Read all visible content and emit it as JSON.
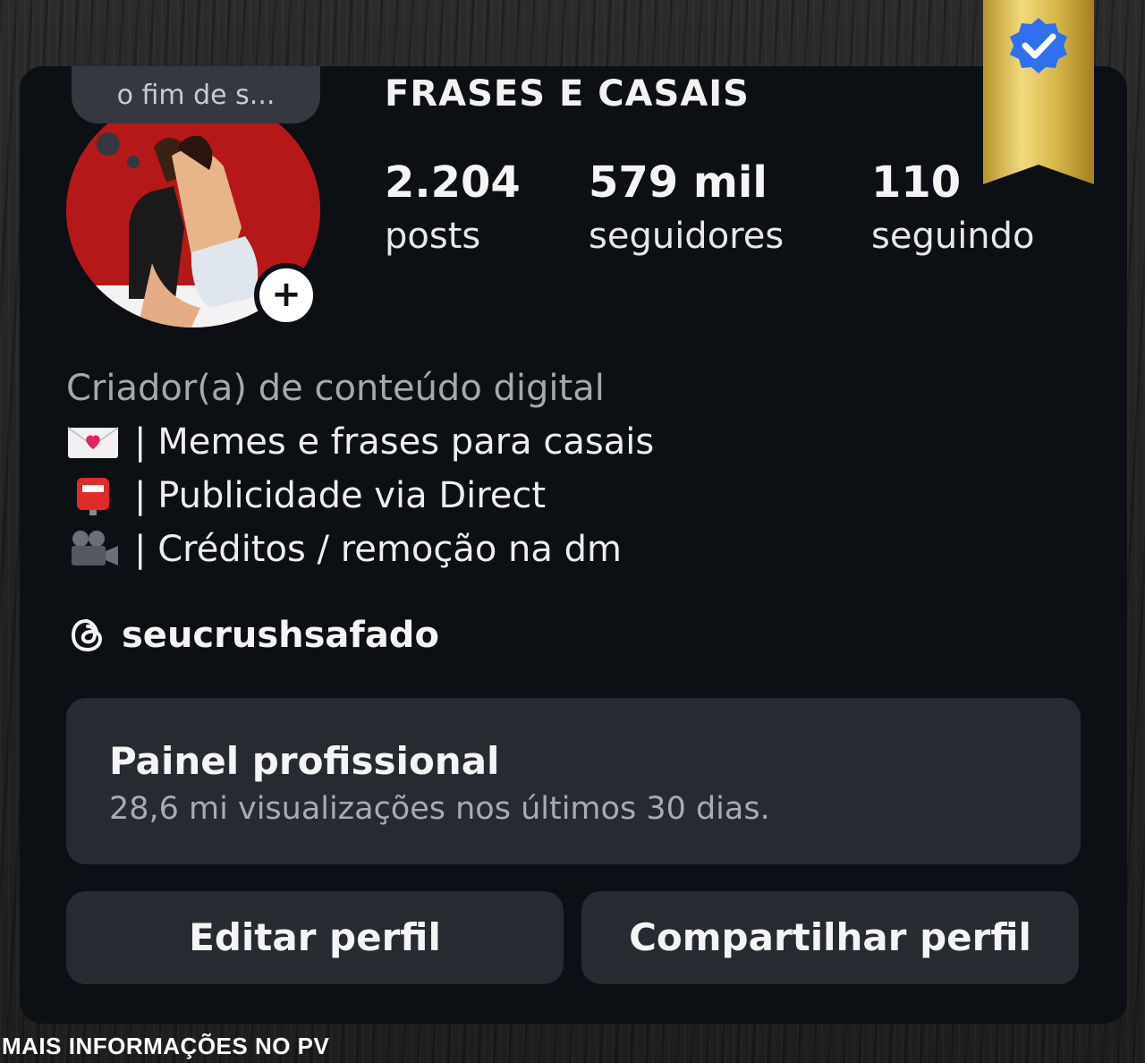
{
  "profile": {
    "note": "o fim de s...",
    "name": "FRASES E CASAIS",
    "add_story_symbol": "+",
    "avatar_icon": "avatar-couple-image"
  },
  "stats": [
    {
      "value": "2.204",
      "label": "posts"
    },
    {
      "value": "579 mil",
      "label": "seguidores"
    },
    {
      "value": "110",
      "label": "seguindo"
    }
  ],
  "bio": {
    "category": "Criador(a) de conteúdo digital",
    "lines": [
      {
        "icon": "love-letter-icon",
        "text": "| Memes e frases para casais"
      },
      {
        "icon": "postbox-icon",
        "text": "| Publicidade via Direct"
      },
      {
        "icon": "movie-camera-icon",
        "text": "| Créditos / remoção na dm"
      }
    ]
  },
  "threads": {
    "icon": "threads-icon",
    "handle": "seucrushsafado"
  },
  "dashboard": {
    "title": "Painel profissional",
    "subtitle": "28,6 mi visualizações nos últimos 30 dias."
  },
  "buttons": {
    "edit": "Editar perfil",
    "share": "Compartilhar perfil"
  },
  "badge": {
    "icon": "verified-badge-icon"
  },
  "footer": "MAIS INFORMAÇÕES NO PV",
  "colors": {
    "card_bg": "#0c0f14",
    "panel_bg": "#262a31",
    "verified_blue": "#2f6ff0",
    "ribbon_gold": "#d8b84a"
  }
}
